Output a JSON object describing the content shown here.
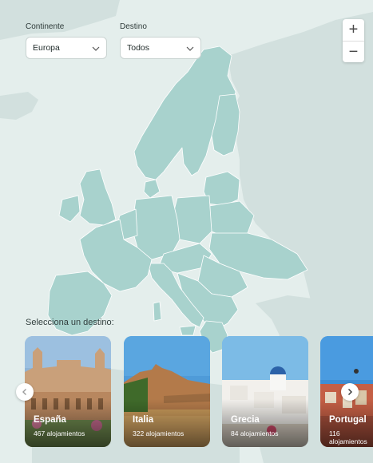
{
  "filters": {
    "continent_label": "Continente",
    "continent_value": "Europa",
    "destination_label": "Destino",
    "destination_value": "Todos"
  },
  "zoom": {
    "in": "+",
    "out": "−"
  },
  "carousel": {
    "title": "Selecciona un destino:",
    "cards": [
      {
        "name": "España",
        "count": "467 alojamientos"
      },
      {
        "name": "Italia",
        "count": "322 alojamientos"
      },
      {
        "name": "Grecia",
        "count": "84 alojamientos"
      },
      {
        "name": "Portugal",
        "count": "116 alojamientos"
      }
    ]
  },
  "icons": {
    "select_arrow": "chevron-down-icon",
    "prev": "chevron-left-icon",
    "next": "chevron-right-icon"
  },
  "colors": {
    "map_background": "#e4eeec",
    "europe_highlight": "#a8d2cd",
    "other_land": "#d2e0de",
    "borders": "#ffffff"
  }
}
